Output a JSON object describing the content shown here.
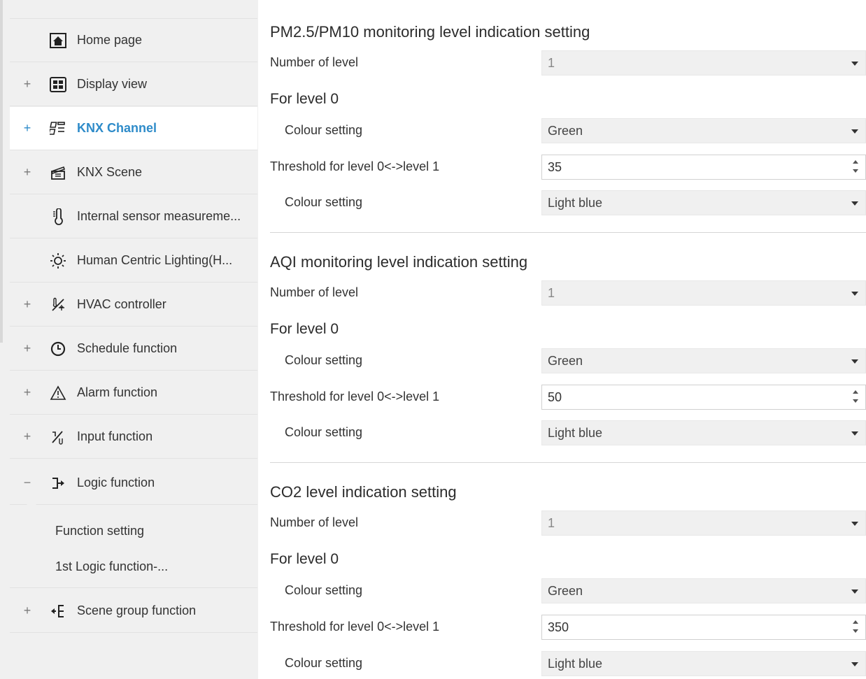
{
  "sidebar": {
    "items": [
      {
        "toggle": "",
        "icon": "home-icon",
        "label": "Home page"
      },
      {
        "toggle": "+",
        "icon": "display-grid-icon",
        "label": "Display view"
      },
      {
        "toggle": "+",
        "icon": "knx-channel-icon",
        "label": "KNX Channel",
        "active": true
      },
      {
        "toggle": "+",
        "icon": "clapperboard-icon",
        "label": "KNX Scene"
      },
      {
        "toggle": "",
        "icon": "thermometer-icon",
        "label": "Internal sensor measureme..."
      },
      {
        "toggle": "",
        "icon": "sun-icon",
        "label": "Human Centric Lighting(H..."
      },
      {
        "toggle": "+",
        "icon": "hvac-icon",
        "label": "HVAC controller"
      },
      {
        "toggle": "+",
        "icon": "clock-icon",
        "label": "Schedule function"
      },
      {
        "toggle": "+",
        "icon": "warning-icon",
        "label": "Alarm function"
      },
      {
        "toggle": "+",
        "icon": "input-icon",
        "label": "Input function"
      },
      {
        "toggle": "−",
        "icon": "logic-icon",
        "label": "Logic function"
      },
      {
        "toggle": "+",
        "icon": "scene-group-icon",
        "label": "Scene group function"
      }
    ],
    "subitems": [
      "Function setting",
      "1st Logic function-..."
    ],
    "accent_color": "#2e8bc9"
  },
  "sections": [
    {
      "title": "PM2.5/PM10 monitoring level indication setting",
      "number_of_level_label": "Number of level",
      "number_of_level_value": "1",
      "level_title": "For level 0",
      "colour_label": "Colour setting",
      "colour_value": "Green",
      "threshold_label": "Threshold for level 0<->level 1",
      "threshold_value": "35",
      "colour2_label": "Colour setting",
      "colour2_value": "Light blue"
    },
    {
      "title": "AQI monitoring level indication setting",
      "number_of_level_label": "Number of level",
      "number_of_level_value": "1",
      "level_title": "For level 0",
      "colour_label": "Colour setting",
      "colour_value": "Green",
      "threshold_label": "Threshold for level 0<->level 1",
      "threshold_value": "50",
      "colour2_label": "Colour setting",
      "colour2_value": "Light blue"
    },
    {
      "title": "CO2 level indication setting",
      "number_of_level_label": "Number of level",
      "number_of_level_value": "1",
      "level_title": "For level 0",
      "colour_label": "Colour setting",
      "colour_value": "Green",
      "threshold_label": "Threshold for level 0<->level 1",
      "threshold_value": "350",
      "colour2_label": "Colour setting",
      "colour2_value": "Light blue"
    }
  ]
}
